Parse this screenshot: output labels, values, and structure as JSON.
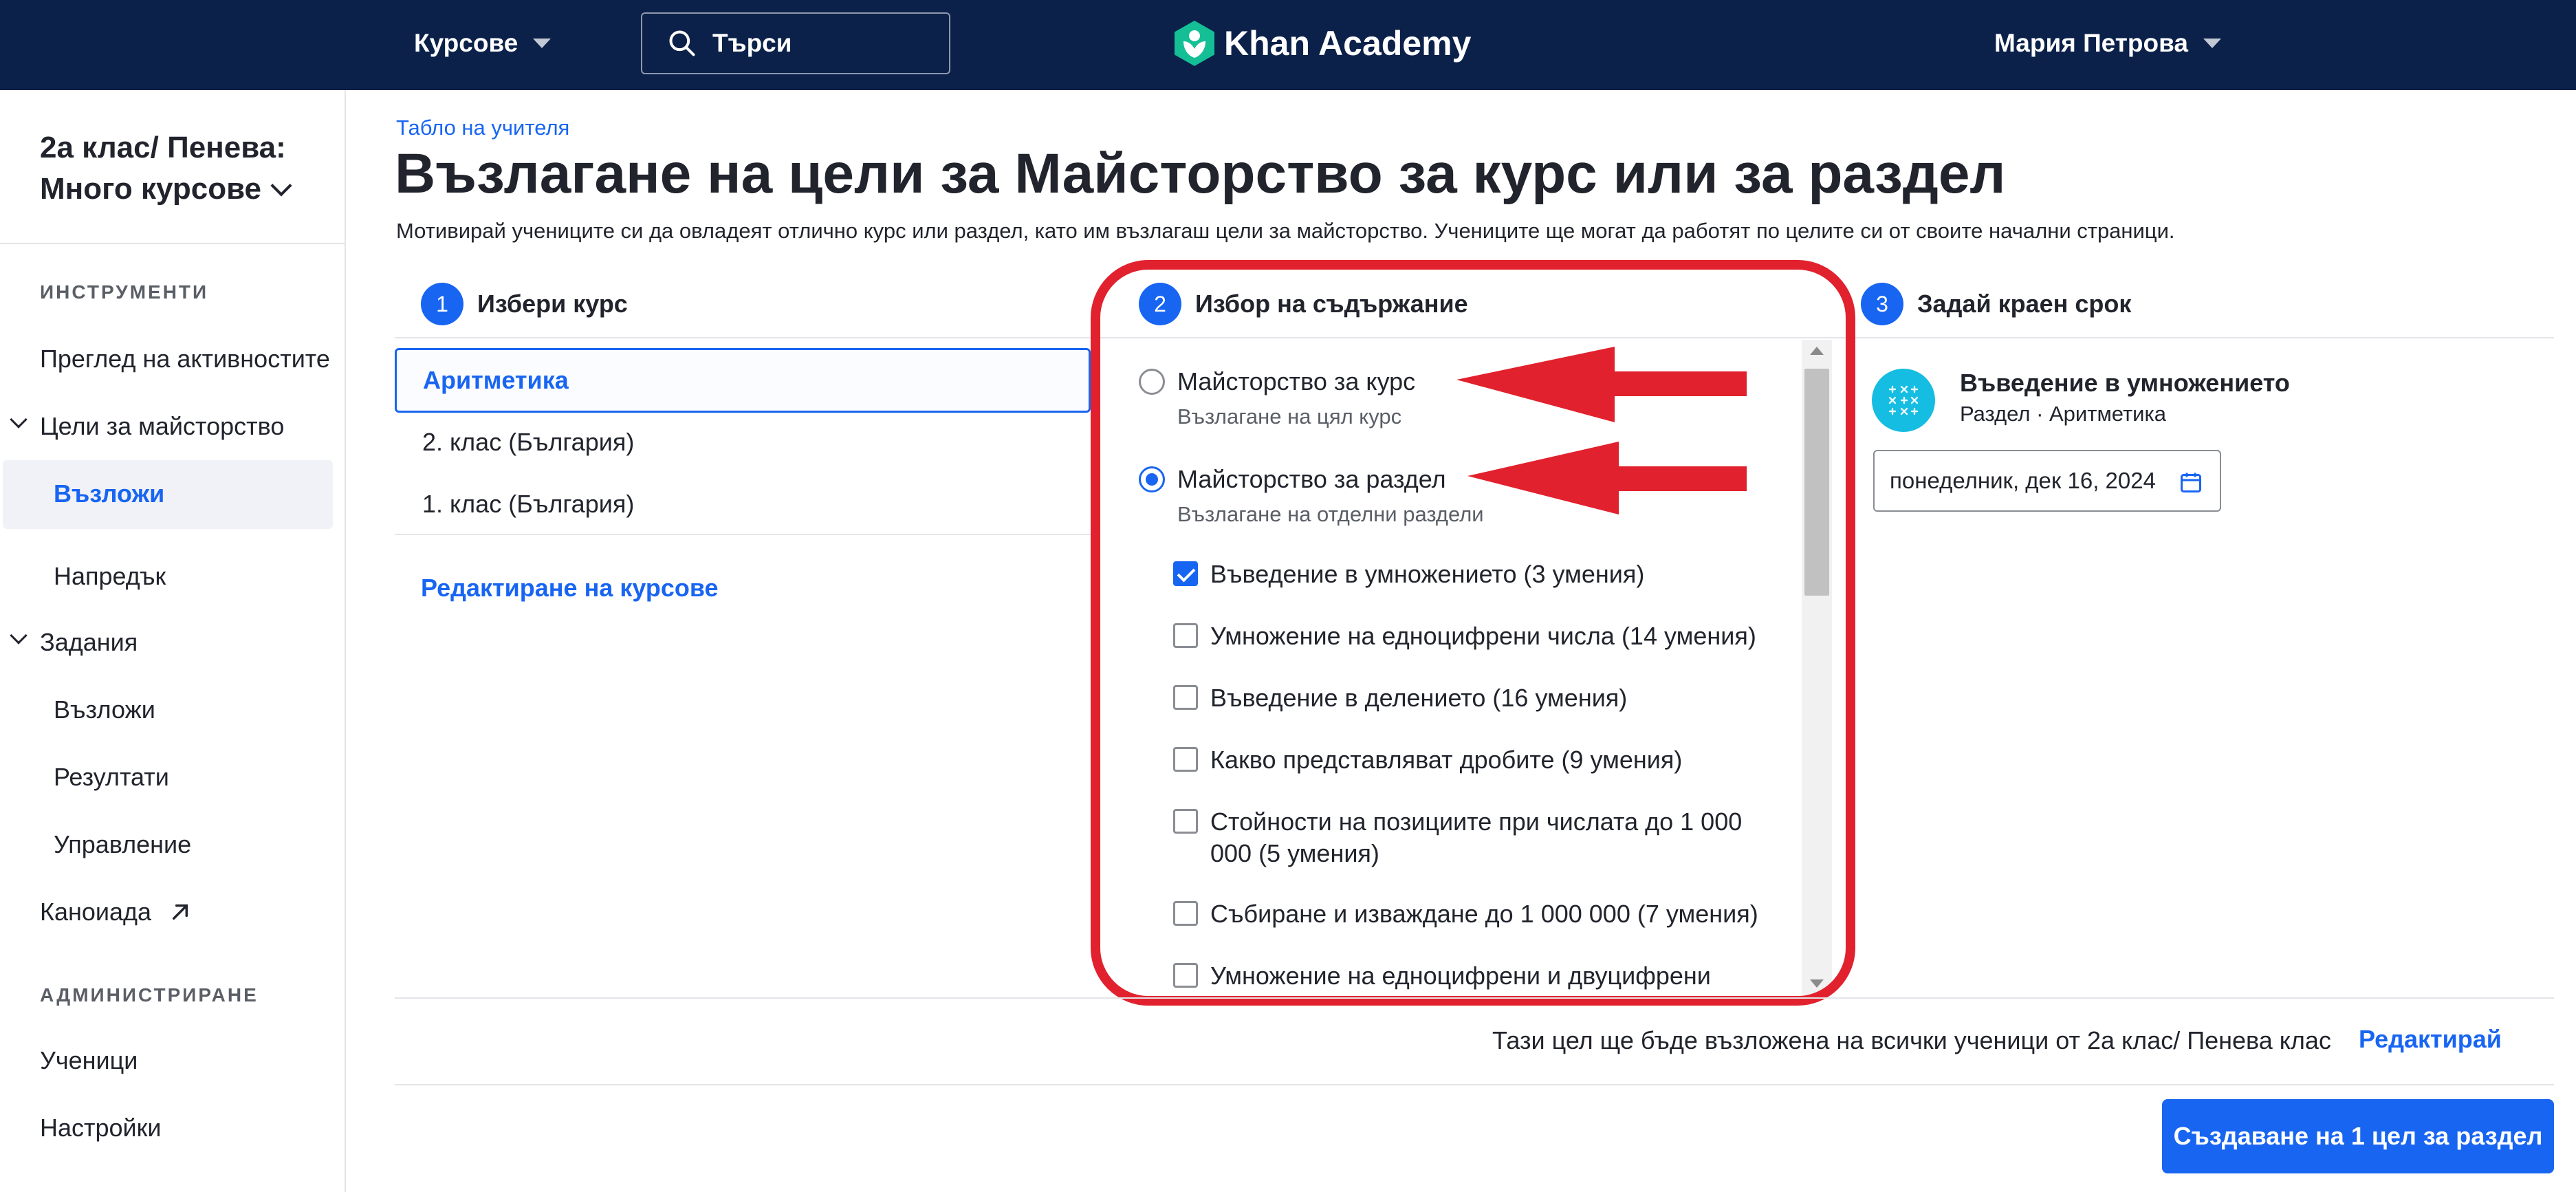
{
  "topnav": {
    "courses_label": "Курсове",
    "search_placeholder": "Търси",
    "logo_text": "Khan Academy",
    "user_name": "Мария Петрова"
  },
  "sidebar": {
    "class_title": "2а клас/ Пенева: Много курсове",
    "tools_heading": "ИНСТРУМЕНТИ",
    "activity_overview": "Преглед на активностите",
    "mastery_goals": "Цели за майсторство",
    "mastery_assign": "Възложи",
    "mastery_progress": "Напредък",
    "assignments": "Задания",
    "assignments_assign": "Възложи",
    "assignments_results": "Резултати",
    "assignments_manage": "Управление",
    "canonaida": "Каноиада",
    "admin_heading": "АДМИНИСТРИРАНЕ",
    "students": "Ученици",
    "settings": "Настройки"
  },
  "main": {
    "breadcrumb": "Табло на учителя",
    "title": "Възлагане на цели за Майсторство за курс или за раздел",
    "description": "Мотивирай учениците си да овладеят отлично курс или раздел, като им възлагаш цели за майсторство. Учениците ще могат да работят по целите си от своите начални страници."
  },
  "steps": [
    {
      "num": "1",
      "label": "Избери курс"
    },
    {
      "num": "2",
      "label": "Избор на съдържание"
    },
    {
      "num": "3",
      "label": "Задай краен срок"
    }
  ],
  "courses": {
    "selected": "Аритметика",
    "items": [
      "2. клас (България)",
      "1. клас (България)"
    ],
    "edit_label": "Редактиране на курсове"
  },
  "content": {
    "course_option": {
      "label": "Майсторство за курс",
      "sub": "Възлагане на цял курс",
      "selected": false
    },
    "unit_option": {
      "label": "Майсторство за раздел",
      "sub": "Възлагане на отделни раздели",
      "selected": true
    },
    "units": [
      {
        "label": "Въведение в умножението (3 умения)",
        "checked": true
      },
      {
        "label": "Умножение на едноцифрени числа (14 умения)",
        "checked": false
      },
      {
        "label": "Въведение в делението (16 умения)",
        "checked": false
      },
      {
        "label": "Какво представляват дробите (9 умения)",
        "checked": false
      },
      {
        "label": "Стойности на позициите при числата до 1 000 000 (5 умения)",
        "checked": false
      },
      {
        "label": "Събиране и изваждане до 1 000 000 (7 умения)",
        "checked": false
      },
      {
        "label": "Умножение на едноцифрени и двуцифрени числа",
        "checked": false
      }
    ]
  },
  "deadline": {
    "unit_title": "Въведение в умножението",
    "unit_meta": "Раздел · Аритметика",
    "date_value": "понеделник, дек 16, 2024"
  },
  "footer": {
    "note": "Тази цел ще бъде възложена на всички ученици от 2а клас/ Пенева клас",
    "edit_label": "Редактирай",
    "create_label": "Създаване на 1 цел за раздел"
  },
  "colors": {
    "nav_bg": "#0b2149",
    "accent": "#1865f2",
    "annotation_red": "#e1212d",
    "logo_green": "#14bf96",
    "unit_icon": "#14bde1"
  }
}
